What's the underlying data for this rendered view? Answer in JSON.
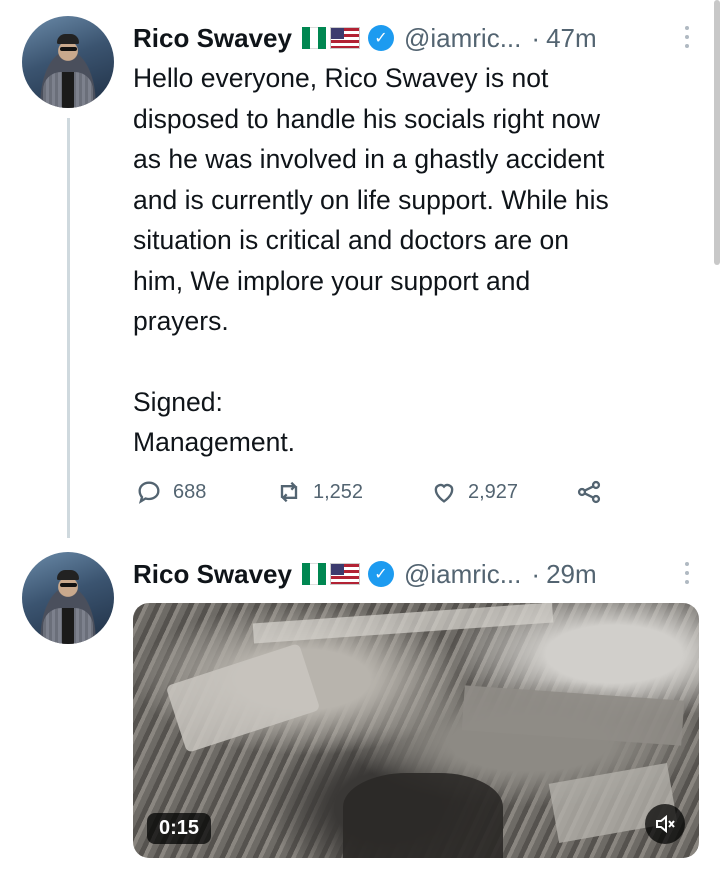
{
  "tweets": [
    {
      "author_name": "Rico Swavey",
      "handle": "@iamric...",
      "separator": "·",
      "time": "47m",
      "body_lines": [
        "Hello everyone, Rico Swavey is not",
        "disposed to handle his socials right now",
        "as he was involved in a ghastly accident",
        "and is currently on life support. While his",
        "situation is critical and doctors are on",
        "him, We implore your support and",
        "prayers."
      ],
      "signature": [
        "Signed:",
        "Management."
      ],
      "replies": "688",
      "retweets": "1,252",
      "likes": "2,927"
    },
    {
      "author_name": "Rico Swavey",
      "handle": "@iamric...",
      "separator": "·",
      "time": "29m",
      "video_duration": "0:15"
    }
  ],
  "icons": {
    "verified": "verified-badge-icon",
    "flag_1": "nigeria-flag-icon",
    "flag_2": "usa-flag-icon",
    "reply": "reply-icon",
    "retweet": "retweet-icon",
    "like": "heart-icon",
    "share": "share-icon",
    "mute": "muted-speaker-icon",
    "more": "more-options-icon"
  },
  "colors": {
    "verified": "#1d9bf0",
    "secondary_text": "#536471",
    "primary_text": "#0f1419"
  }
}
